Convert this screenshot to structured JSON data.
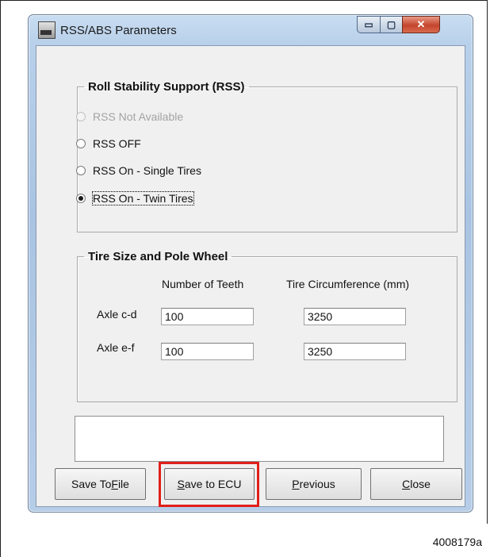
{
  "window": {
    "title": "RSS/ABS Parameters",
    "app_icon": "rss-app-icon"
  },
  "titlebar_buttons": {
    "minimize": "▭",
    "maximize": "▢",
    "close": "✕"
  },
  "rss_group": {
    "legend": "Roll Stability Support (RSS)",
    "options": [
      {
        "label": "RSS Not Available",
        "state": "disabled"
      },
      {
        "label": "RSS OFF",
        "state": "unchecked"
      },
      {
        "label": "RSS On - Single Tires",
        "state": "unchecked"
      },
      {
        "label": "RSS On - Twin Tires",
        "state": "checked"
      }
    ]
  },
  "tire_group": {
    "legend": "Tire Size and Pole Wheel",
    "col_teeth": "Number of Teeth",
    "col_circumference": "Tire Circumference (mm)",
    "rows": [
      {
        "label": "Axle c-d",
        "teeth": "100",
        "circumference": "3250"
      },
      {
        "label": "Axle e-f",
        "teeth": "100",
        "circumference": "3250"
      }
    ]
  },
  "status_message": "",
  "buttons": {
    "save_file": {
      "pre": "Save To ",
      "ul": "F",
      "post": "ile"
    },
    "save_ecu": {
      "pre": "",
      "ul": "S",
      "post": "ave to ECU"
    },
    "previous": {
      "pre": "",
      "ul": "P",
      "post": "revious"
    },
    "close": {
      "pre": "",
      "ul": "C",
      "post": "lose"
    }
  },
  "highlight_color": "#e0201a",
  "figure_label": "4008179a"
}
